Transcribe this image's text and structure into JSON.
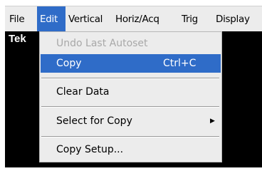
{
  "menubar": {
    "items": [
      {
        "label": "File"
      },
      {
        "label": "Edit"
      },
      {
        "label": "Vertical"
      },
      {
        "label": "Horiz/Acq"
      },
      {
        "label": "Trig"
      },
      {
        "label": "Display"
      }
    ],
    "selected": "Edit"
  },
  "scope": {
    "logo": "Tek"
  },
  "edit_menu": {
    "items": [
      {
        "label": "Undo Last Autoset",
        "enabled": false
      },
      {
        "label": "Copy",
        "shortcut": "Ctrl+C",
        "highlighted": true
      },
      {
        "label": "Clear Data"
      },
      {
        "label": "Select for Copy",
        "submenu_icon": "triangle-right-icon"
      },
      {
        "label": "Copy Setup..."
      }
    ]
  },
  "colors": {
    "menu_background": "#ececec",
    "highlight": "#2f6cc8",
    "scope_background": "#000000",
    "disabled_text": "#a8a8a8"
  }
}
